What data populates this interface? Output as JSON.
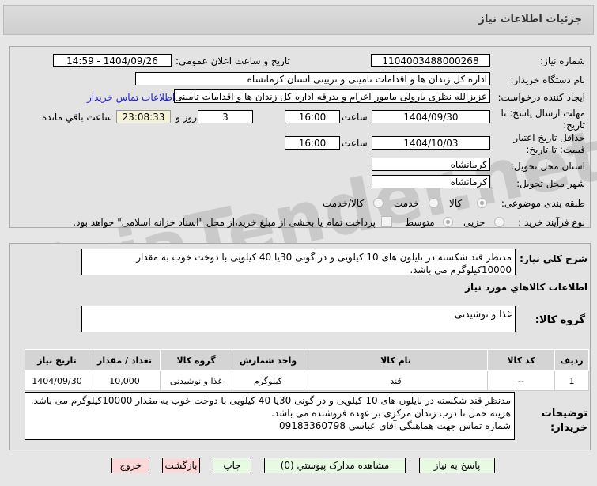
{
  "header": {
    "title": "جزئیات اطلاعات نیاز"
  },
  "form": {
    "need_number_label": "شماره نیاز:",
    "need_number": "1104003488000268",
    "announce_label": "تاریخ و ساعت اعلان عمومي:",
    "announce_value": "1404/09/26 - 14:59",
    "buyer_org_label": "نام دستگاه خریدار:",
    "buyer_org": "اداره کل زندان ها و اقدامات تامینی و تربیتی استان کرمانشاه",
    "creator_label": "ایجاد کننده درخواست:",
    "creator": "عزیزالله نظری یارولی مامور اعزام و بدرقه اداره کل زندان ها و اقدامات تامینی و تربیتی استان کرمانشاه",
    "contact_link": "اطلاعات تماس خریدار",
    "reply_deadline_label": "مهلت ارسال پاسخ: تا تاریخ:",
    "reply_date": "1404/09/30",
    "time_label": "ساعت",
    "reply_time": "16:00",
    "days": "3",
    "days_label": "روز و",
    "remaining": "23:08:33",
    "remaining_label": "ساعت باقي مانده",
    "price_validity_label": "حداقل تاریخ اعتبار قیمت: تا تاریخ:",
    "price_date": "1404/10/03",
    "price_time": "16:00",
    "province_label": "استان محل تحویل:",
    "province": "کرمانشاه",
    "city_label": "شهر محل تحویل:",
    "city": "کرمانشاه",
    "category_label": "طبقه بندی موضوعی:",
    "category_options": [
      "کالا",
      "خدمت",
      "کالا/خدمت"
    ],
    "category_selected": "کالا",
    "process_label": "نوع فرآیند خرید :",
    "process_options": [
      "جزیی",
      "متوسط"
    ],
    "process_selected": "متوسط",
    "payment_note": "پرداخت تمام یا بخشی از مبلغ خرید،از محل \"اسناد خزانه اسلامی\" خواهد بود."
  },
  "details": {
    "description_label": "شرح کلي نیاز:",
    "description": "مدنظر قند شکسته در نایلون های 10 کیلویی و در گونی 30یا 40 کیلویی با دوخت خوب به مقدار 10000کیلوگرم می باشد.",
    "goods_heading": "اطلاعات کالاهاي مورد نیاز",
    "group_label": "گروه کالا:",
    "group": "غذا و نوشیدنی",
    "table": {
      "headers": [
        "ردیف",
        "کد کالا",
        "نام کالا",
        "واحد شمارش",
        "گروه کالا",
        "تعداد / مقدار",
        "تاریخ نیاز"
      ],
      "rows": [
        [
          "1",
          "--",
          "قند",
          "کیلوگرم",
          "غذا و نوشیدنی",
          "10,000",
          "1404/09/30"
        ]
      ]
    },
    "notes_label": "توضیحات خریدار:",
    "notes": [
      "مدنظر قند شکسته در نایلون های 10 کیلویی و در گونی 30یا 40 کیلویی با دوخت خوب به مقدار 10000کیلوگرم می باشد.",
      "هزینه حمل تا درب زندان مرکزی بر عهده فروشنده می باشد.",
      "شماره تماس جهت هماهنگی آقای عباسی 09183360798"
    ]
  },
  "buttons": {
    "reply": "پاسخ به نیاز",
    "attachments": "مشاهده مدارک پیوستي (0)",
    "print": "چاپ",
    "back": "بازگشت",
    "exit": "خروج"
  },
  "watermark": "AriaTender.net"
}
